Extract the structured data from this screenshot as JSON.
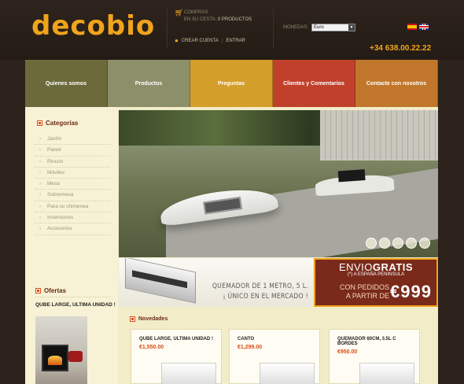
{
  "header": {
    "logo_text": "decobio",
    "cart": {
      "label": "COMPRAS",
      "status_prefix": "EN SU CESTA:",
      "count_text": "0 PRODUCTOS"
    },
    "account": {
      "create_label": "CREAR CUENTA",
      "separator": "|",
      "login_label": "ENTRAR"
    },
    "currency": {
      "label": "MONEDAS:",
      "selected": "Euro"
    },
    "phone": "+34 638.00.22.22",
    "languages": [
      "es-flag-icon",
      "uk-flag-icon"
    ]
  },
  "nav": {
    "items": [
      {
        "label": "Quienes somos",
        "color": "#6c6a3a"
      },
      {
        "label": "Productos",
        "color": "#8d8f6a"
      },
      {
        "label": "Preguntas",
        "color": "#d39e2a"
      },
      {
        "label": "Clientes y Comentarios",
        "color": "#c0402b"
      },
      {
        "label": "Contacte con nosotros",
        "color": "#c1772b"
      }
    ]
  },
  "sidebar": {
    "categories_title": "Categorías",
    "categories": [
      "Jardín",
      "Pared",
      "Rincón",
      "Móviles",
      "Mesa",
      "Sobremesa",
      "Para su chimenea",
      "Inserciones",
      "Accesorios"
    ],
    "offers_title": "Ofertas",
    "offer_name": "QUBE LARGE, ULTIMA UNIDAD !"
  },
  "promo": {
    "product_line1": "QUEMADOR DE 1 METRO, 5 L.",
    "product_line2": "¡ ÚNICO EN EL MERCADO !",
    "shipping_part1": "ENVIO",
    "shipping_part2": "GRATIS",
    "shipping_sub": "(*) A ESPAÑA PENINSULA",
    "cond_line1": "CON PEDIDOS",
    "cond_line2": "A PARTIR DE",
    "threshold": "€999"
  },
  "novedades": {
    "title": "Novedades",
    "products": [
      {
        "name": "QUBE LARGE, ULTIMA UNIDAD !",
        "price": "€1,550.00"
      },
      {
        "name": "CANTO",
        "price": "€1,299.00"
      },
      {
        "name": "QUEMADOR 60CM, 3.5L C BORDES",
        "price": "€950.00"
      }
    ]
  },
  "slider": {
    "slides": 5
  },
  "colors": {
    "accent": "#f0a41c",
    "price": "#d94c14",
    "background": "#2c221b"
  }
}
